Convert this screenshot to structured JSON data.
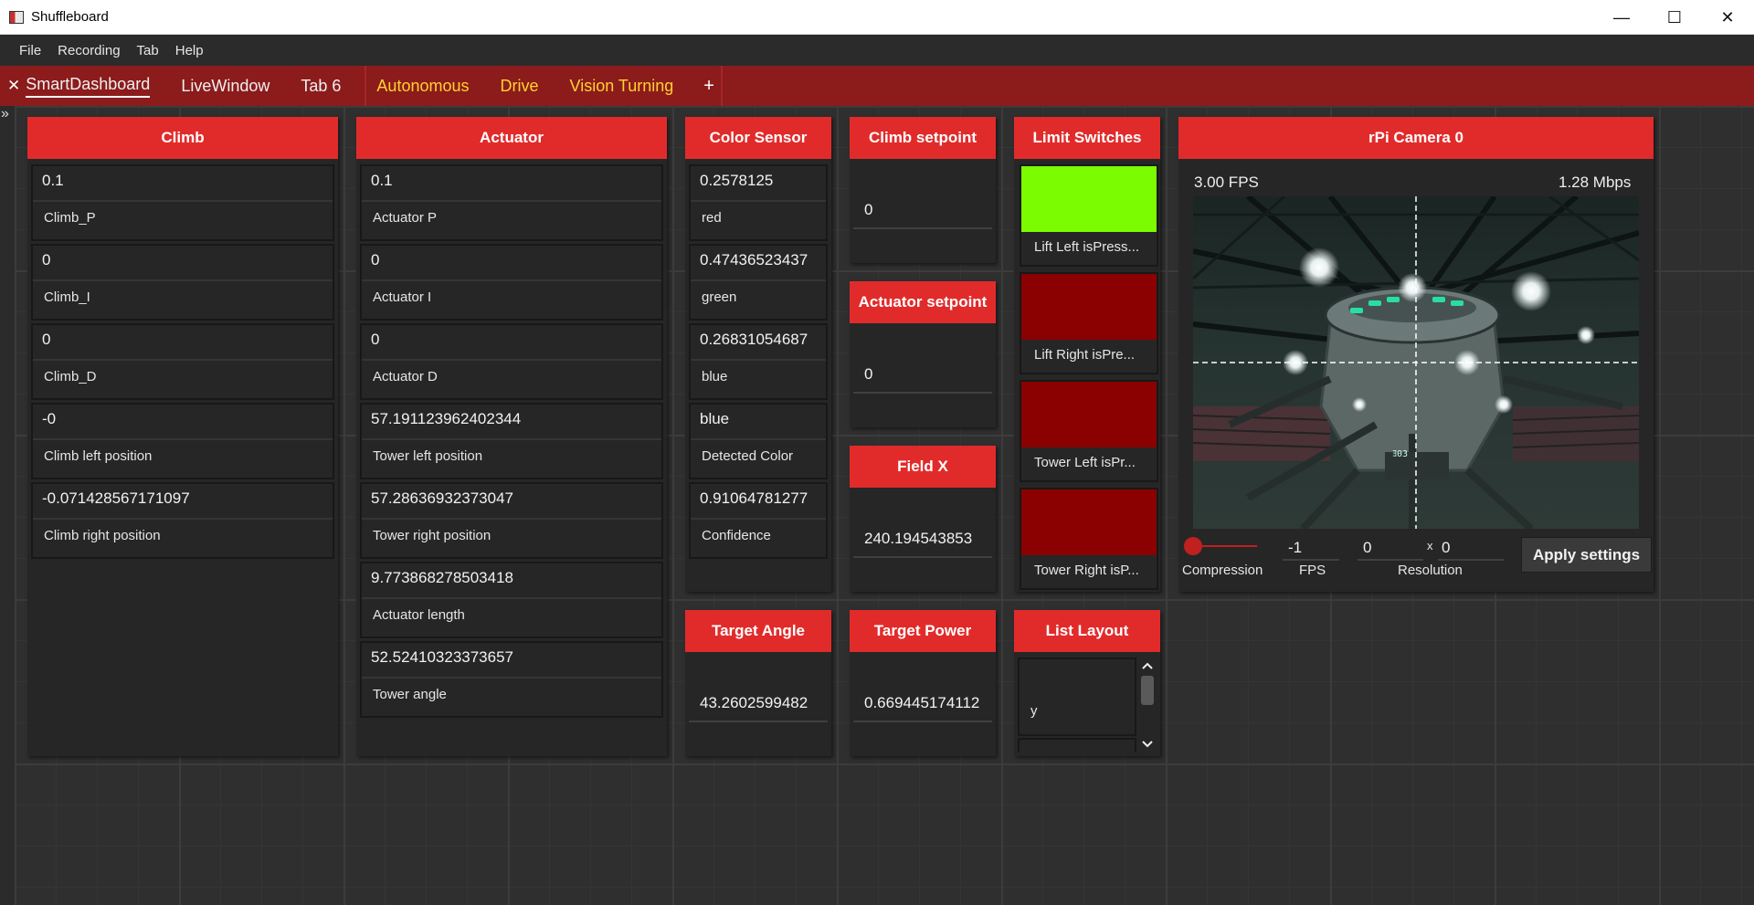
{
  "window": {
    "title": "Shuffleboard",
    "min_icon": "—",
    "max_icon": "☐",
    "close_icon": "✕"
  },
  "menu": [
    "File",
    "Recording",
    "Tab",
    "Help"
  ],
  "tabs": {
    "close_icon": "✕",
    "items": [
      {
        "label": "SmartDashboard"
      },
      {
        "label": "LiveWindow"
      },
      {
        "label": "Tab 6"
      },
      {
        "label": "Autonomous"
      },
      {
        "label": "Drive"
      },
      {
        "label": "Vision Turning"
      }
    ],
    "add_label": "+"
  },
  "sidebar": {
    "expand_icon": "»"
  },
  "climb": {
    "title": "Climb",
    "entries": [
      {
        "value": "0.1",
        "label": "Climb_P"
      },
      {
        "value": "0",
        "label": "Climb_I"
      },
      {
        "value": "0",
        "label": "Climb_D"
      },
      {
        "value": "-0",
        "label": "Climb left position"
      },
      {
        "value": "-0.071428567171097",
        "label": "Climb right position"
      }
    ]
  },
  "actuator": {
    "title": "Actuator",
    "entries": [
      {
        "value": "0.1",
        "label": "Actuator P"
      },
      {
        "value": "0",
        "label": "Actuator I"
      },
      {
        "value": "0",
        "label": "Actuator D"
      },
      {
        "value": "57.191123962402344",
        "label": "Tower left position"
      },
      {
        "value": "57.28636932373047",
        "label": "Tower right position"
      },
      {
        "value": "9.773868278503418",
        "label": "Actuator length"
      },
      {
        "value": "52.52410323373657",
        "label": "Tower angle"
      }
    ]
  },
  "color_sensor": {
    "title": "Color Sensor",
    "entries": [
      {
        "value": "0.2578125",
        "label": "red"
      },
      {
        "value": "0.47436523437",
        "label": "green"
      },
      {
        "value": "0.26831054687",
        "label": "blue"
      },
      {
        "value": "blue",
        "label": "Detected Color"
      },
      {
        "value": "0.91064781277",
        "label": "Confidence"
      }
    ]
  },
  "climb_setpoint": {
    "title": "Climb setpoint",
    "value": "0"
  },
  "actuator_setpoint": {
    "title": "Actuator setpoint",
    "value": "0"
  },
  "field_x": {
    "title": "Field X",
    "value": "240.194543853"
  },
  "target_angle": {
    "title": "Target Angle",
    "value": "43.2602599482"
  },
  "target_power": {
    "title": "Target Power",
    "value": "0.669445174112"
  },
  "limit_switches": {
    "title": "Limit Switches",
    "true_color": "#7cfc00",
    "false_color": "#8b0000",
    "items": [
      {
        "label": "Lift Left isPress...",
        "state": true
      },
      {
        "label": "Lift Right isPre...",
        "state": false
      },
      {
        "label": "Tower Left isPr...",
        "state": false
      },
      {
        "label": "Tower Right isP...",
        "state": false
      }
    ]
  },
  "list_layout": {
    "title": "List Layout",
    "item_label": "y",
    "scroll_up_icon": "chevron-up-icon",
    "scroll_down_icon": "chevron-down-icon"
  },
  "camera": {
    "title": "rPi Camera 0",
    "fps": "3.00 FPS",
    "bandwidth": "1.28 Mbps",
    "compression_label": "Compression",
    "fps_label": "FPS",
    "fps_value": "-1",
    "resolution_label": "Resolution",
    "res_w": "0",
    "res_x": "x",
    "res_h": "0",
    "apply_label": "Apply settings",
    "overlay_text": "ﾖ03"
  },
  "colors": {
    "accent": "#e12b2b",
    "tab_bar": "#8c1b1b",
    "yellow_tab": "#ffd230"
  }
}
